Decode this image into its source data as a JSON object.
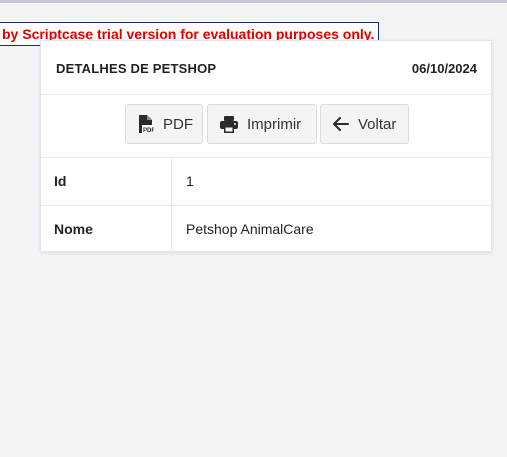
{
  "banner": {
    "text": "by Scriptcase trial version for evaluation purposes only."
  },
  "card": {
    "title": "DETALHES DE PETSHOP",
    "date": "06/10/2024"
  },
  "toolbar": {
    "pdf_label": "PDF",
    "print_label": "Imprimir",
    "back_label": "Voltar"
  },
  "fields": [
    {
      "label": "Id",
      "value": "1"
    },
    {
      "label": "Nome",
      "value": "Petshop AnimalCare"
    }
  ],
  "icons": {
    "pdf": "pdf-file-icon",
    "print": "printer-icon",
    "back": "arrow-left-icon"
  },
  "colors": {
    "banner_text": "#e00000",
    "banner_border": "#1a2b6b",
    "background": "#f3f4f8"
  }
}
